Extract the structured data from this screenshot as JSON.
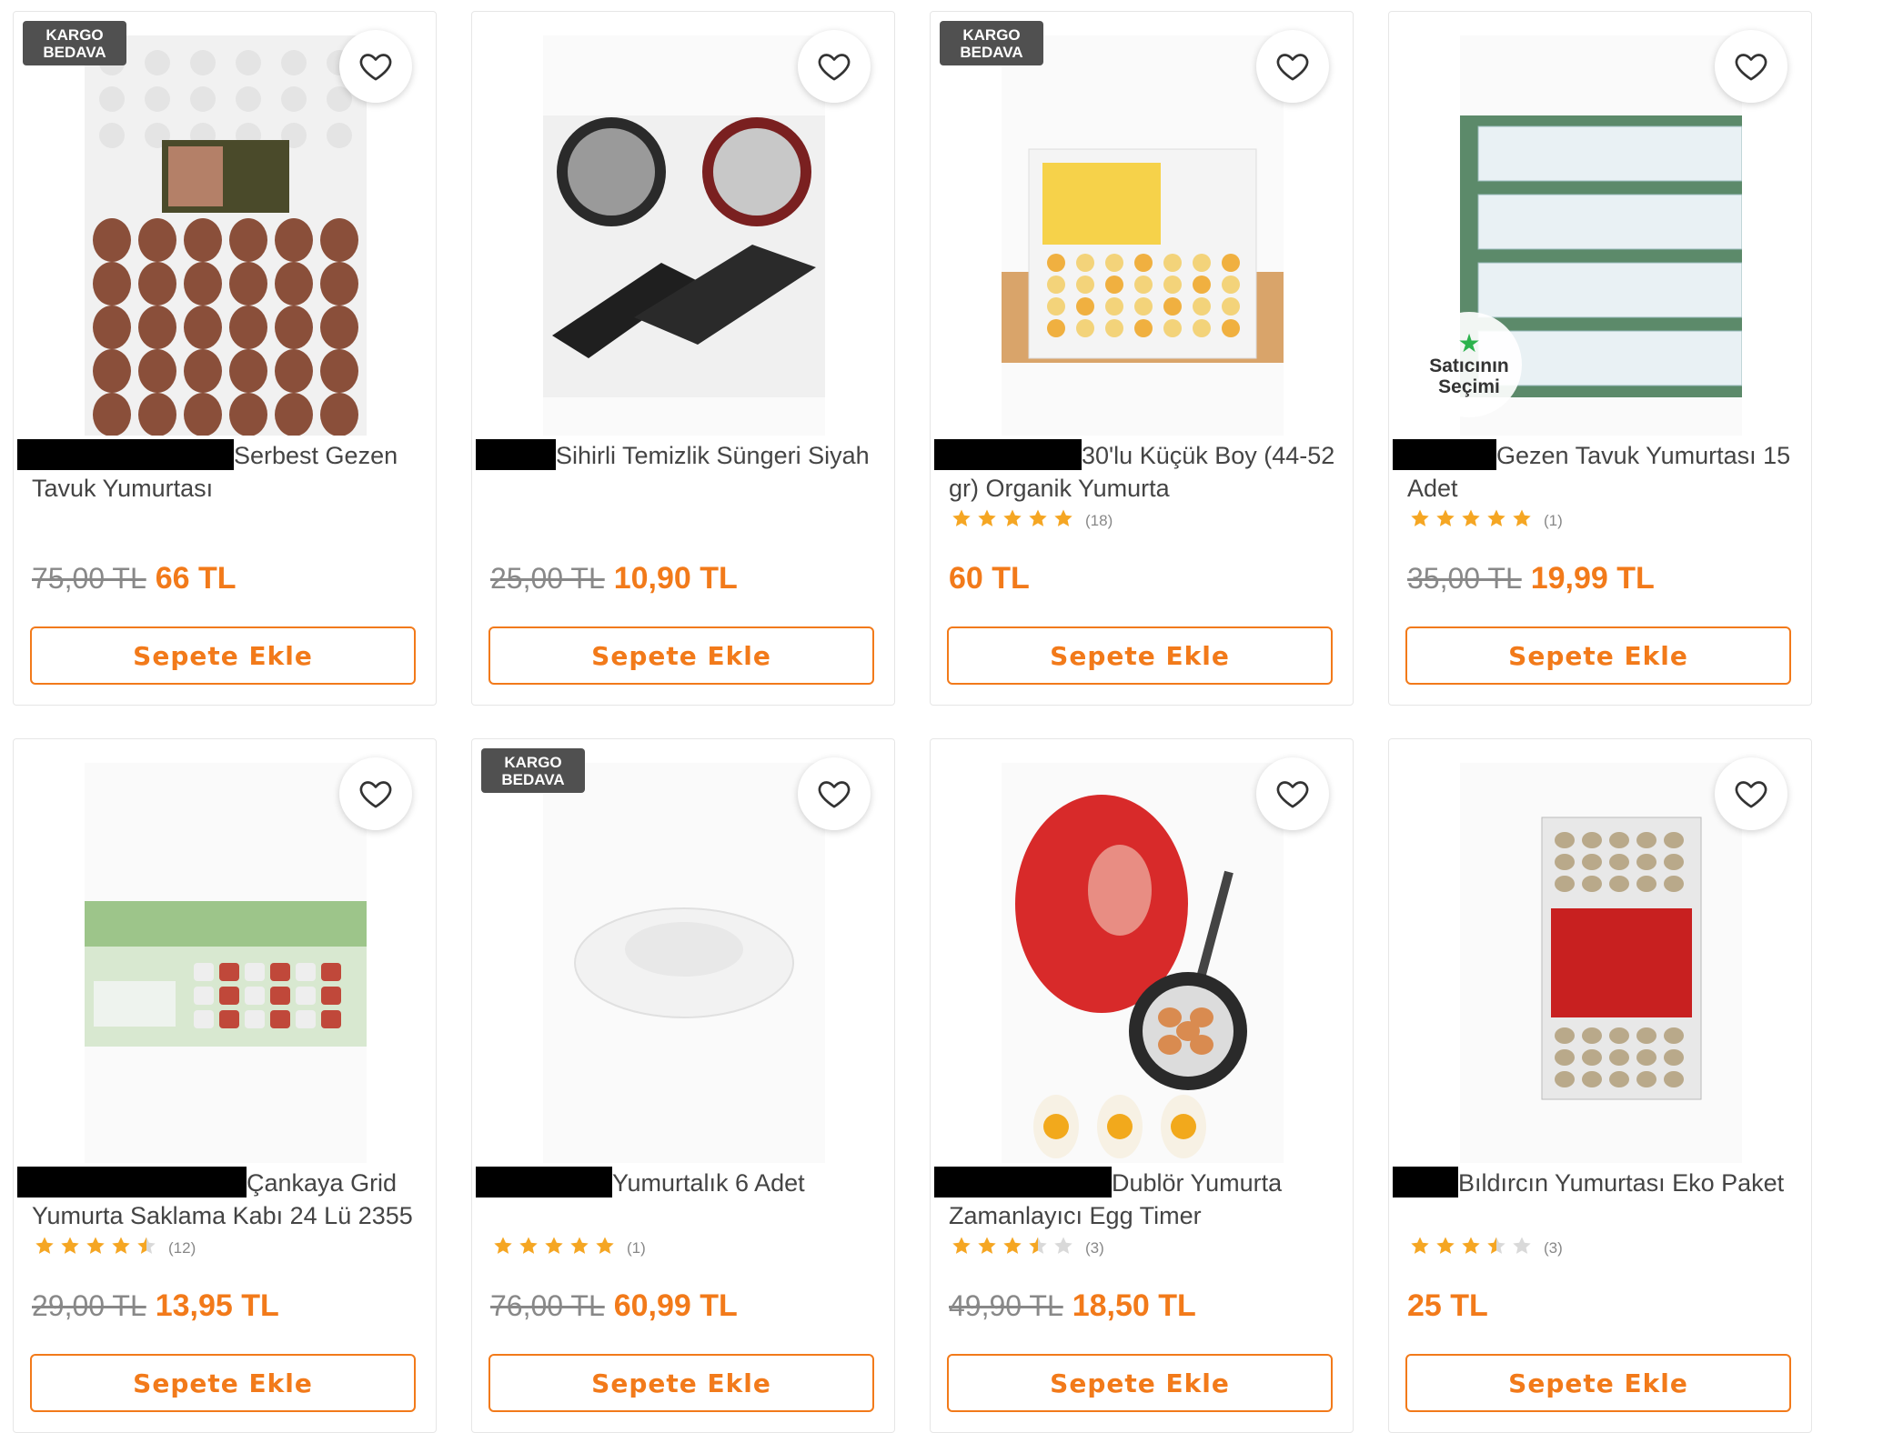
{
  "labels": {
    "free_shipping": "KARGO BEDAVA",
    "add_to_cart": "Sepete Ekle",
    "seller_choice_line1": "Satıcının",
    "seller_choice_line2": "Seçimi"
  },
  "colors": {
    "accent": "#f27a1a",
    "star_filled": "#f5a623",
    "star_empty": "#d9d9d9",
    "badge_bg": "#505050",
    "seller_choice_star": "#2bb24c"
  },
  "products": [
    {
      "title": "Serbest Gezen Tavuk Yumurtası",
      "rating": null,
      "review_count": "",
      "old_price": "75,00 TL",
      "price": "66 TL",
      "free_shipping": true,
      "seller_choice": false,
      "image": "brown-eggs-tray"
    },
    {
      "title": "Sihirli Temizlik Süngeri Siyah",
      "rating": null,
      "review_count": "",
      "old_price": "25,00 TL",
      "price": "10,90 TL",
      "free_shipping": false,
      "seller_choice": false,
      "image": "black-sponges"
    },
    {
      "title": "30'lu Küçük Boy (44-52 gr) Organik Yumurta",
      "rating": 5,
      "review_count": "(18)",
      "old_price": "",
      "price": "60 TL",
      "free_shipping": true,
      "seller_choice": false,
      "image": "organic-eggs-box"
    },
    {
      "title": "Gezen Tavuk Yumurtası 15 Adet",
      "rating": 5,
      "review_count": "(1)",
      "old_price": "35,00 TL",
      "price": "19,99 TL",
      "free_shipping": false,
      "seller_choice": true,
      "image": "egg-cartons-stack"
    },
    {
      "title": "Çankaya Grid Yumurta Saklama Kabı 24 Lü 2355",
      "rating": 4.5,
      "review_count": "(12)",
      "old_price": "29,00 TL",
      "price": "13,95 TL",
      "free_shipping": false,
      "seller_choice": false,
      "image": "egg-storage-box"
    },
    {
      "title": "Yumurtalık 6 Adet",
      "rating": 5,
      "review_count": "(1)",
      "old_price": "76,00 TL",
      "price": "60,99 TL",
      "free_shipping": true,
      "seller_choice": false,
      "image": "white-egg-plate"
    },
    {
      "title": "Dublör Yumurta Zamanlayıcı Egg Timer",
      "rating": 3.5,
      "review_count": "(3)",
      "old_price": "49,90 TL",
      "price": "18,50 TL",
      "free_shipping": false,
      "seller_choice": false,
      "image": "egg-timer"
    },
    {
      "title": "Bıldırcın Yumurtası Eko Paket",
      "rating": 3.5,
      "review_count": "(3)",
      "old_price": "",
      "price": "25 TL",
      "free_shipping": false,
      "seller_choice": false,
      "image": "quail-eggs-pack"
    }
  ]
}
